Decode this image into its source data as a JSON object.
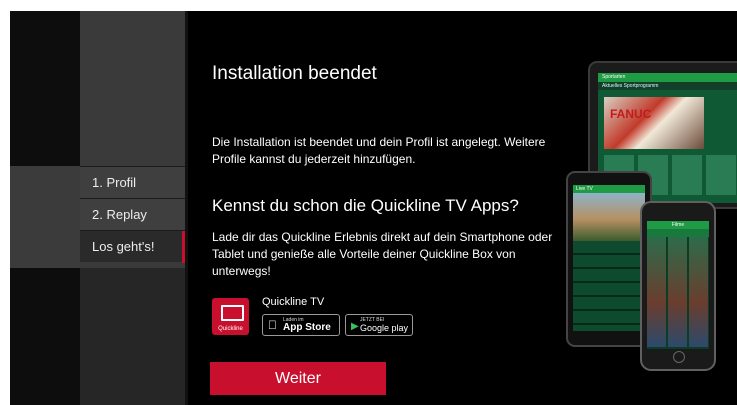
{
  "steps": [
    {
      "label": "1. Profil"
    },
    {
      "label": "2. Replay"
    },
    {
      "label": "Los geht's!"
    }
  ],
  "main": {
    "title": "Installation beendet",
    "description": "Die Installation ist beendet und dein Profil ist angelegt. Weitere Profile kannst du jederzeit hinzufügen.",
    "subtitle": "Kennst du schon die Quickline TV Apps?",
    "body": "Lade dir das Quickline Erlebnis direkt auf dein Smartphone oder Tablet und genieße alle Vorteile deiner Quickline Box von unterwegs!"
  },
  "app": {
    "brand": "Quickline",
    "name": "Quickline TV",
    "appstore_small": "Laden im",
    "appstore": "App Store",
    "googleplay_small": "JETZT BEI",
    "googleplay": "Google play"
  },
  "devices": {
    "tablet_header": "Sportarten",
    "tablet_subheader": "Aktuelles Sportprogramm",
    "tablet_hero_text": "FANUC",
    "phone_left_header": "Live TV",
    "phone_right_header": "Filme"
  },
  "button": {
    "label": "Weiter"
  },
  "colors": {
    "accent": "#c8102e",
    "background": "#000000",
    "app_green": "#1f9a45"
  }
}
